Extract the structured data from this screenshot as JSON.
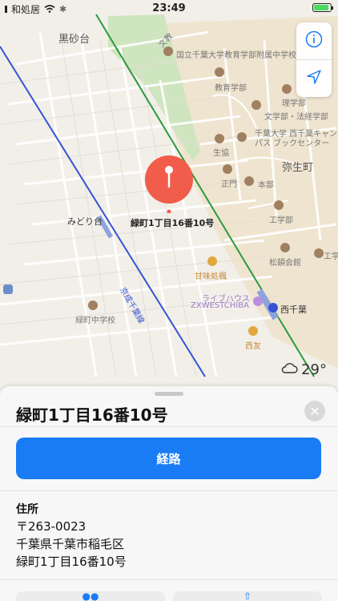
{
  "status": {
    "carrier": "和処居",
    "time": "23:49"
  },
  "map": {
    "labels": {
      "kurosunadai": "黒砂台",
      "kokuritsu_school": "国立千葉大学教育学部附属中学校",
      "kyoikugakubu": "教育学部",
      "rigakubu": "理学部",
      "bungaku": "文学部・法経学部",
      "chiba_univ_campus": "千葉大学 西千葉キャンパスブックセンター",
      "seikyo": "生協",
      "yayoicho": "弥生町",
      "seimon": "正門",
      "honbu": "本部",
      "kogakubu": "工学部",
      "shoutoku": "松韻会館",
      "kogaku2": "工学",
      "midoridai": "みどり台",
      "kanmidokoro": "甘味処楓",
      "livehouse_jp": "ライブハウス",
      "livehouse_en": "ZXWESTCHIBA",
      "nishichiba": "西千葉",
      "seiyu": "西友",
      "midori_school": "緑町中学校",
      "keisei_line": "京成千葉線",
      "road_top": "文教"
    },
    "pin_label": "緑町1丁目16番10号",
    "weather": "29°"
  },
  "sheet": {
    "title": "緑町1丁目16番10号",
    "route_label": "経路",
    "address_label": "住所",
    "address_lines": [
      "〒263-0023",
      "千葉県千葉市稲毛区",
      "緑町1丁目16番10号"
    ]
  },
  "colors": {
    "accent": "#1a7cf5",
    "pin": "#f25c4a",
    "rail_green": "#2a9a3e",
    "rail_blue": "#3552d6"
  },
  "icons": {
    "info": "info-icon",
    "location": "location-arrow-icon",
    "close": "close-icon",
    "cloud": "cloud-icon",
    "wifi": "wifi-icon",
    "pin": "map-pin-icon"
  }
}
